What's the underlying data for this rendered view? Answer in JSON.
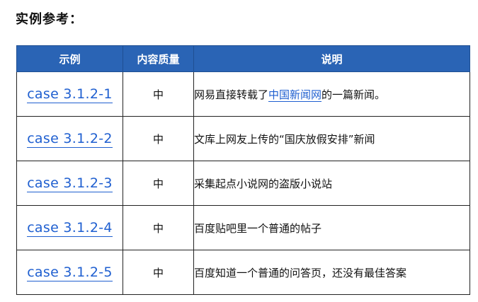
{
  "heading": "实例参考：",
  "table": {
    "headers": [
      "示例",
      "内容质量",
      "说明"
    ],
    "rows": [
      {
        "case": "case 3.1.2-1",
        "quality": "中",
        "desc_pre": "网易直接转载了",
        "desc_link": "中国新闻网",
        "desc_post": "的一篇新闻。"
      },
      {
        "case": "case 3.1.2-2",
        "quality": "中",
        "desc_pre": "文库上网友上传的“国庆放假安排”新闻"
      },
      {
        "case": "case 3.1.2-3",
        "quality": "中",
        "desc_pre": "采集起点小说网的盗版小说站"
      },
      {
        "case": "case 3.1.2-4",
        "quality": "中",
        "desc_pre": "百度贴吧里一个普通的帖子"
      },
      {
        "case": "case 3.1.2-5",
        "quality": "中",
        "desc_pre": "百度知道一个普通的问答页，还没有最佳答案"
      }
    ]
  },
  "colors": {
    "header_bg": "#2a64b5",
    "link": "#1f5fd0"
  }
}
